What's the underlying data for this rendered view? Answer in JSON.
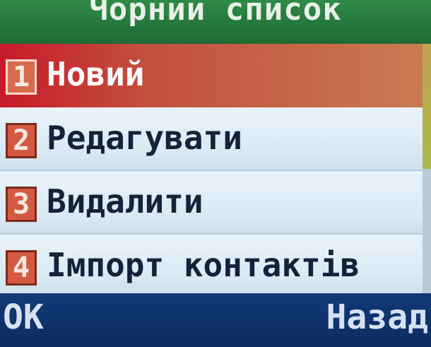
{
  "header": {
    "title": "Чорний список"
  },
  "menu": {
    "items": [
      {
        "number": "1",
        "label": "Новий",
        "selected": true
      },
      {
        "number": "2",
        "label": "Редагувати",
        "selected": false
      },
      {
        "number": "3",
        "label": "Видалити",
        "selected": false
      },
      {
        "number": "4",
        "label": "Імпорт контактів",
        "selected": false
      }
    ]
  },
  "softkeys": {
    "left": "OK",
    "right": "Назад"
  },
  "scrollbar": {
    "position_fraction": 0.0,
    "visible_fraction": 0.5
  },
  "colors": {
    "title_bar": "#2f8a48",
    "selected_row": "#c81a2a",
    "softkey_bar": "#123a78",
    "number_badge": "#d35a41"
  }
}
